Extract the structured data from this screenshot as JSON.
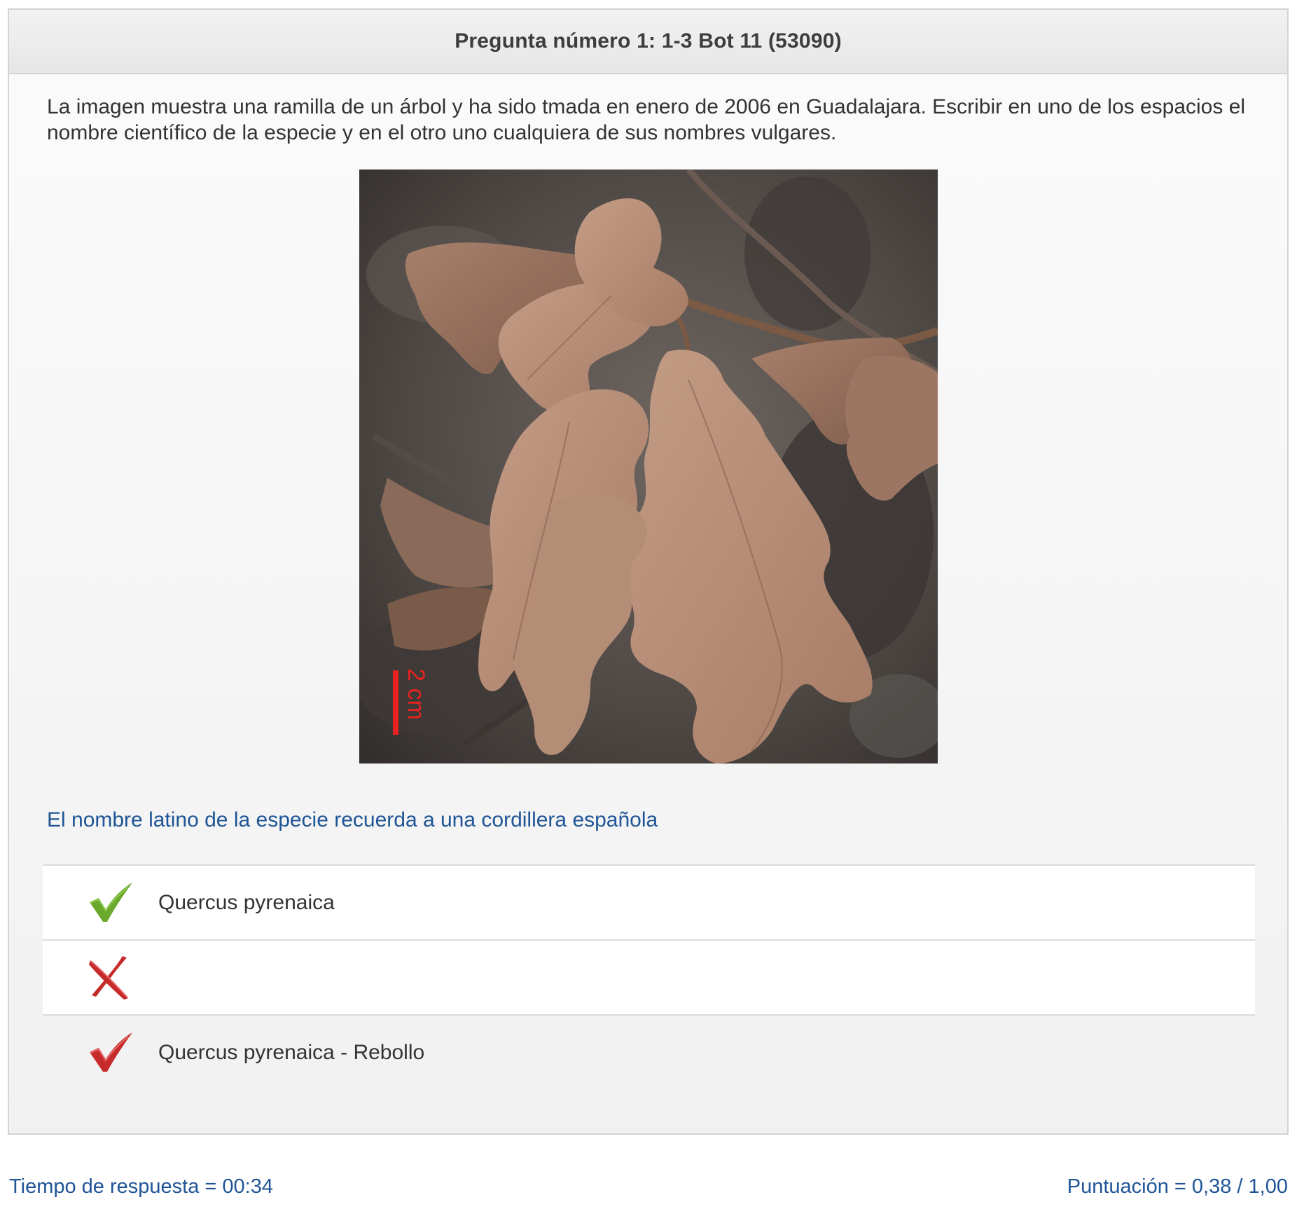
{
  "header": {
    "title": "Pregunta número 1:  1-3 Bot 11 (53090)"
  },
  "question": {
    "text": "La imagen muestra una ramilla de un árbol y ha sido tmada en enero de 2006 en Guadalajara. Escribir en uno de los espacios el nombre científico de la especie y en el otro uno cualquiera de sus nombres vulgares."
  },
  "photo": {
    "scale_label": "2 cm",
    "scale_color": "#e8231f"
  },
  "hint": {
    "text": "El nombre latino de la especie recuerda a una cordillera española"
  },
  "answers": [
    {
      "icon": "check-green-icon",
      "text": "Quercus pyrenaica"
    },
    {
      "icon": "cross-red-icon",
      "text": ""
    },
    {
      "icon": "check-red-icon",
      "text": "Quercus pyrenaica - Rebollo"
    }
  ],
  "footer": {
    "response_time": "Tiempo de respuesta = 00:34",
    "score": "Puntuación = 0,38 / 1,00"
  },
  "colors": {
    "link_blue": "#1f5596",
    "check_green": "#6aa82e",
    "check_red": "#c62a2a"
  }
}
